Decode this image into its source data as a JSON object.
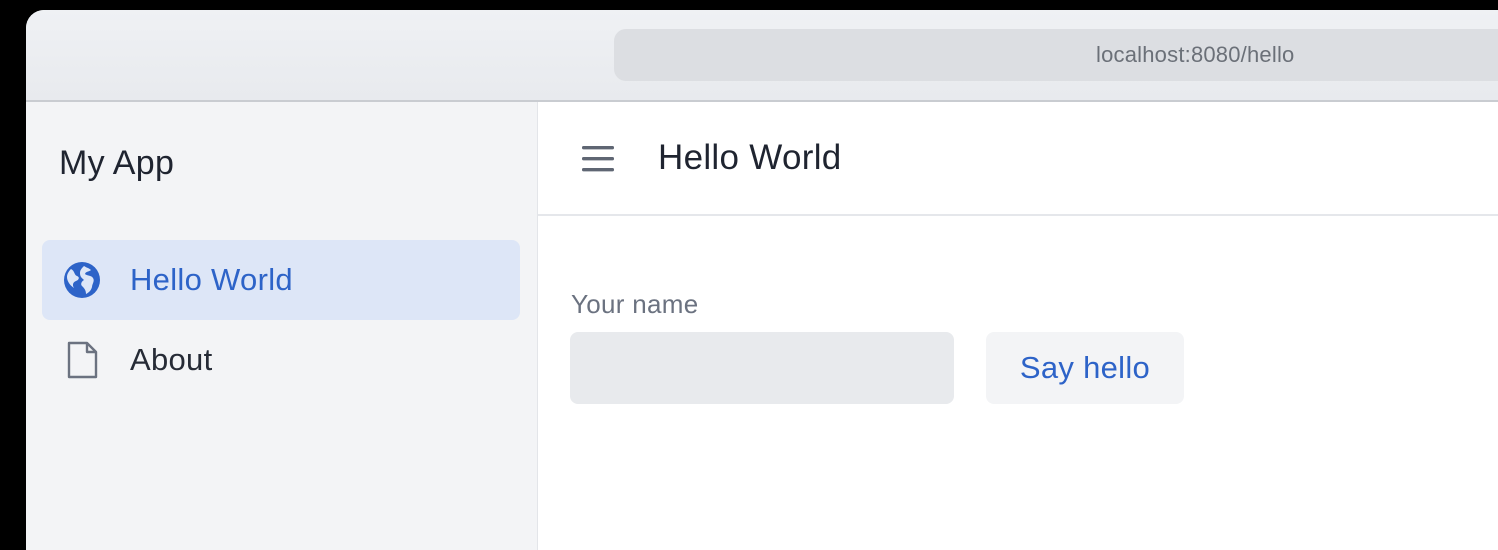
{
  "browser": {
    "url": "localhost:8080/hello"
  },
  "sidebar": {
    "app_title": "My App",
    "items": [
      {
        "label": "Hello World",
        "icon": "globe-icon",
        "active": true
      },
      {
        "label": "About",
        "icon": "file-icon",
        "active": false
      }
    ]
  },
  "header": {
    "menu_icon": "hamburger-menu-icon",
    "title": "Hello World"
  },
  "form": {
    "name_label": "Your name",
    "name_value": "",
    "button_label": "Say hello"
  },
  "colors": {
    "accent": "#2d63c8",
    "active_bg": "#dde6f7",
    "sidebar_bg": "#f3f4f6",
    "input_bg": "#e8eaed"
  }
}
